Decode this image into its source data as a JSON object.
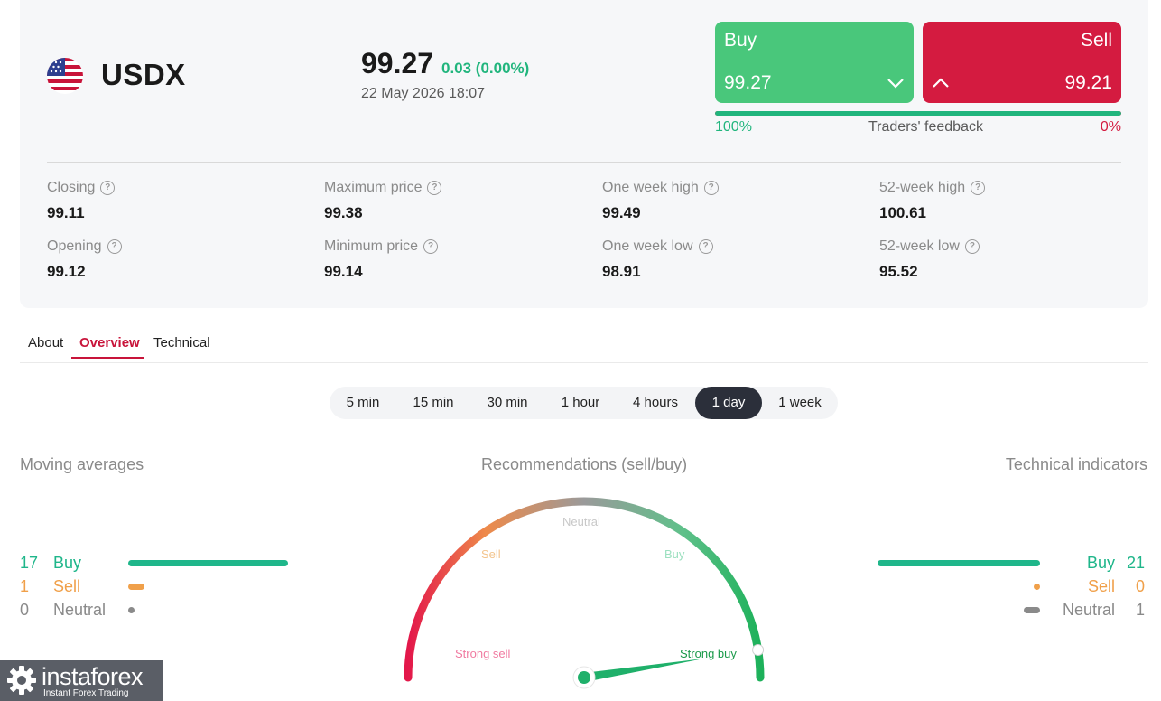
{
  "instrument": {
    "flag_icon": "us-flag-icon",
    "symbol": "USDX",
    "price": "99.27",
    "change": "0.03 (0.00%)",
    "timestamp": "22 May 2026 18:07"
  },
  "trade": {
    "buy_label": "Buy",
    "buy_price": "99.27",
    "sell_label": "Sell",
    "sell_price": "99.21",
    "buy_color": "#49c77b",
    "sell_color": "#d41b40"
  },
  "feedback": {
    "buy_percent": "100%",
    "title": "Traders' feedback",
    "sell_percent": "0%",
    "buy_share": 1.0
  },
  "stats": [
    {
      "label": "Closing",
      "value": "99.11"
    },
    {
      "label": "Maximum price",
      "value": "99.38"
    },
    {
      "label": "One week high",
      "value": "99.49"
    },
    {
      "label": "52-week high",
      "value": "100.61"
    },
    {
      "label": "Opening",
      "value": "99.12"
    },
    {
      "label": "Minimum price",
      "value": "99.14"
    },
    {
      "label": "One week low",
      "value": "98.91"
    },
    {
      "label": "52-week low",
      "value": "95.52"
    }
  ],
  "tabs": [
    {
      "label": "About"
    },
    {
      "label": "Overview",
      "active": true
    },
    {
      "label": "Technical"
    }
  ],
  "timeframes": [
    {
      "label": "5 min"
    },
    {
      "label": "15 min"
    },
    {
      "label": "30 min"
    },
    {
      "label": "1 hour"
    },
    {
      "label": "4 hours"
    },
    {
      "label": "1 day",
      "active": true
    },
    {
      "label": "1 week"
    }
  ],
  "moving_averages": {
    "title": "Moving averages",
    "rows": [
      {
        "count": "17",
        "label": "Buy",
        "value": 17,
        "color": "#1fb68a"
      },
      {
        "count": "1",
        "label": "Sell",
        "value": 1,
        "color": "#f0a04a"
      },
      {
        "count": "0",
        "label": "Neutral",
        "value": 0,
        "color": "#8a8a8a"
      }
    ]
  },
  "recommendations": {
    "title": "Recommendations (sell/buy)",
    "labels": {
      "strong_sell": "Strong sell",
      "sell": "Sell",
      "neutral": "Neutral",
      "buy": "Buy",
      "strong_buy": "Strong buy"
    },
    "needle_level": 0.95,
    "selected": "Strong buy"
  },
  "technical_indicators": {
    "title": "Technical indicators",
    "rows": [
      {
        "count": "21",
        "label": "Buy",
        "value": 21,
        "color": "#1fb68a"
      },
      {
        "count": "0",
        "label": "Sell",
        "value": 0,
        "color": "#f0a04a"
      },
      {
        "count": "1",
        "label": "Neutral",
        "value": 1,
        "color": "#8a8a8a"
      }
    ]
  },
  "logo": {
    "brand": "instaforex",
    "tagline": "Instant Forex Trading"
  }
}
